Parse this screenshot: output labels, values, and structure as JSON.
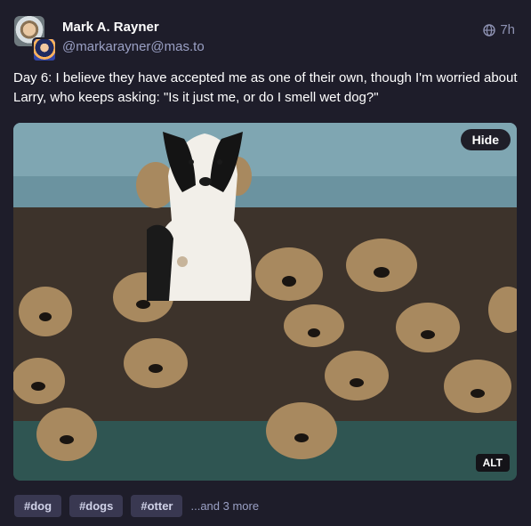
{
  "author": {
    "display_name": "Mark A. Rayner",
    "handle": "@markarayner@mas.to"
  },
  "post": {
    "time": "7h",
    "visibility_icon": "globe-icon",
    "text": "Day 6: I believe they have accepted me as one of their own, though I'm worried about Larry, who keeps asking: \"Is it just me, or do I smell wet dog?\""
  },
  "media": {
    "hide_label": "Hide",
    "alt_label": "ALT"
  },
  "hashtags": [
    "#dog",
    "#dogs",
    "#otter"
  ],
  "more_tags": "...and 3 more"
}
